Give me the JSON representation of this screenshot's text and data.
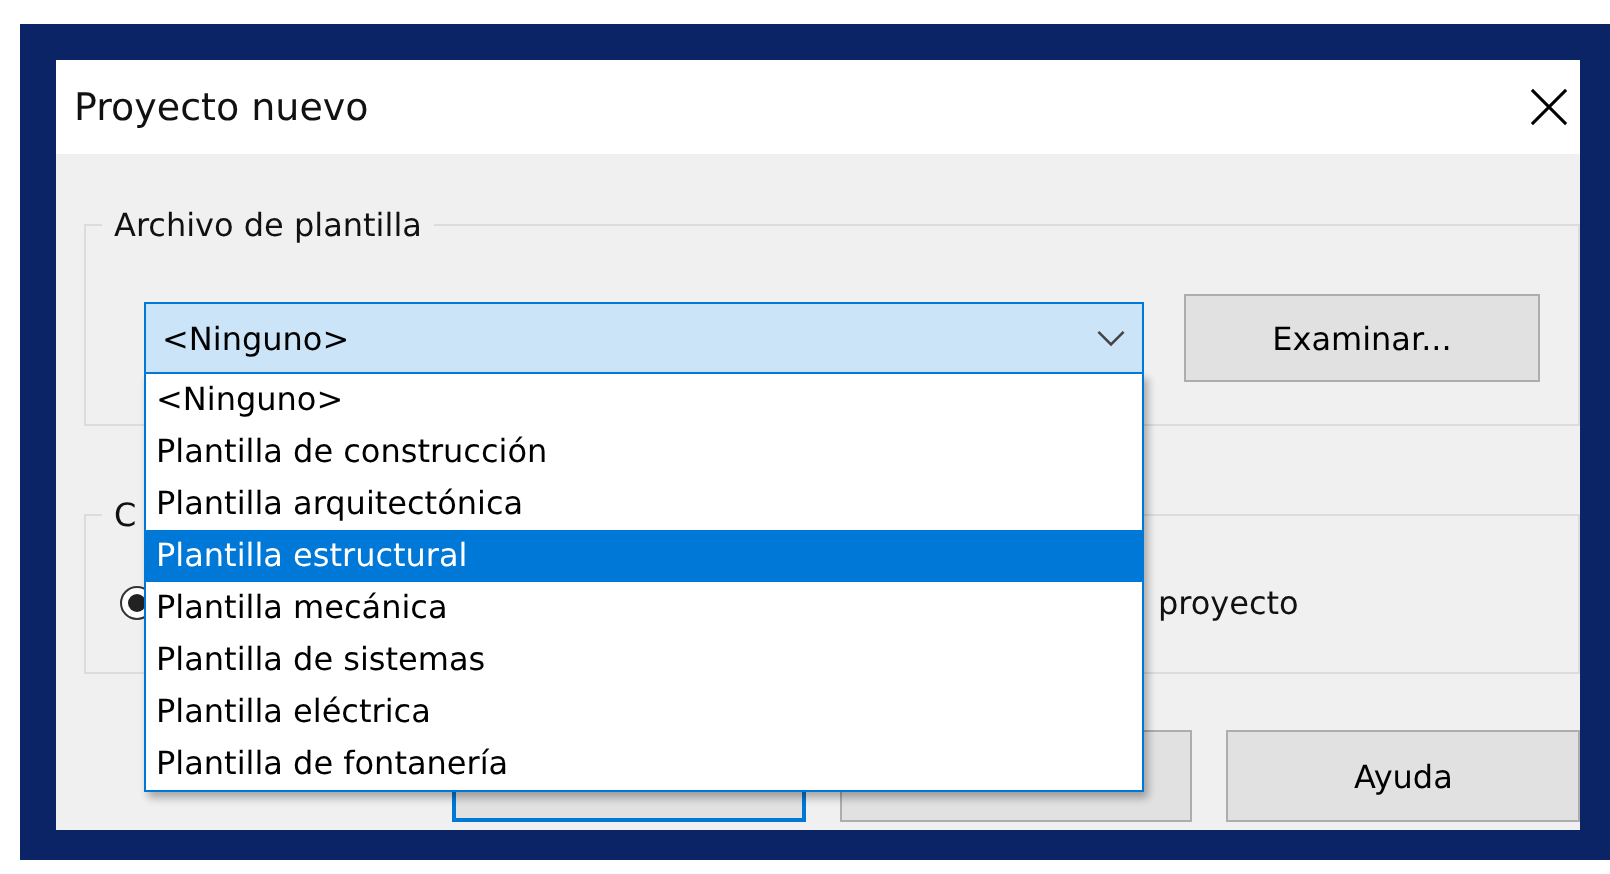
{
  "window": {
    "title": "Proyecto nuevo"
  },
  "template_group": {
    "label": "Archivo de plantilla",
    "combo": {
      "value": "<Ninguno>",
      "expanded": true
    },
    "browse_button": "Examinar...",
    "options": [
      {
        "label": "<Ninguno>",
        "selected": false
      },
      {
        "label": "Plantilla de construcción",
        "selected": false
      },
      {
        "label": "Plantilla arquitectónica",
        "selected": false
      },
      {
        "label": "Plantilla estructural",
        "selected": true
      },
      {
        "label": "Plantilla mecánica",
        "selected": false
      },
      {
        "label": "Plantilla de sistemas",
        "selected": false
      },
      {
        "label": "Plantilla eléctrica",
        "selected": false
      },
      {
        "label": "Plantilla de fontanería",
        "selected": false
      }
    ]
  },
  "create_group": {
    "label": "C",
    "radio": {
      "selected": true
    },
    "option_text": "proyecto"
  },
  "buttons": [
    {
      "kind": "default"
    },
    {
      "kind": "plain"
    },
    {
      "kind": "plain",
      "label": "Ayuda"
    }
  ]
}
